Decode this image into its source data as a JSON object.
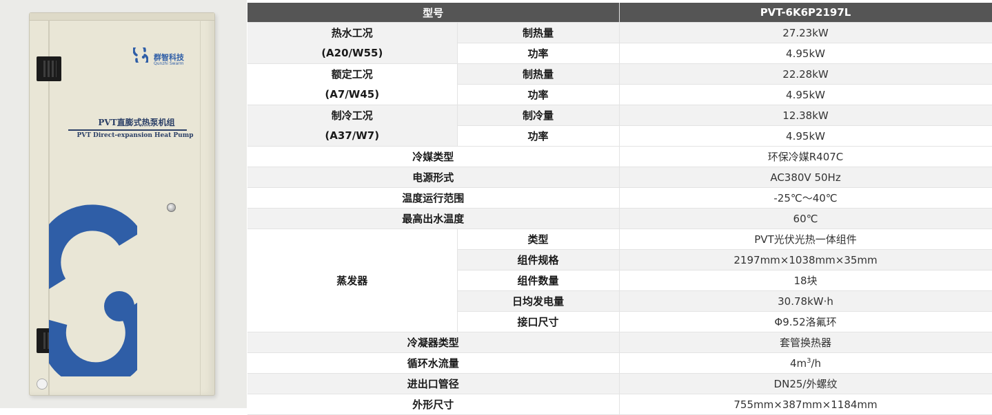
{
  "product": {
    "brand_name": "群智科技",
    "brand_sub": "Qunzhi Swarm",
    "title_cn": "PVT直膨式热泵机组",
    "title_en": "PVT Direct-expansion Heat Pump",
    "brand_color": "#2f5ea7"
  },
  "table": {
    "header": {
      "label": "型号",
      "value": "PVT-6K6P2197L"
    },
    "hot_water": {
      "label_line1": "热水工况",
      "label_line2": "(A20/W55)",
      "heat_label": "制热量",
      "heat_value": "27.23kW",
      "power_label": "功率",
      "power_value": "4.95kW"
    },
    "rated": {
      "label_line1": "额定工况",
      "label_line2": "(A7/W45)",
      "heat_label": "制热量",
      "heat_value": "22.28kW",
      "power_label": "功率",
      "power_value": "4.95kW"
    },
    "cooling": {
      "label_line1": "制冷工况",
      "label_line2": "(A37/W7)",
      "cool_label": "制冷量",
      "cool_value": "12.38kW",
      "power_label": "功率",
      "power_value": "4.95kW"
    },
    "refrigerant": {
      "label": "冷媒类型",
      "value": "环保冷媒R407C"
    },
    "power_supply": {
      "label": "电源形式",
      "value": "AC380V 50Hz"
    },
    "temp_range": {
      "label": "温度运行范围",
      "value": "-25℃～40℃"
    },
    "max_water_temp": {
      "label": "最高出水温度",
      "value": "60℃"
    },
    "evaporator": {
      "label": "蒸发器",
      "type_label": "类型",
      "type_value": "PVT光伏光热一体组件",
      "spec_label": "组件规格",
      "spec_value": "2197mm×1038mm×35mm",
      "count_label": "组件数量",
      "count_value": "18块",
      "daily_label": "日均发电量",
      "daily_value": "30.78kW·h",
      "port_label": "接口尺寸",
      "port_value": "Φ9.52洛氟环"
    },
    "condenser": {
      "label": "冷凝器类型",
      "value": "套管换热器"
    },
    "flow": {
      "label": "循环水流量",
      "value_number": "4m",
      "value_sup": "3",
      "value_unit": "/h"
    },
    "pipe": {
      "label": "进出口管径",
      "value": "DN25/外螺纹"
    },
    "dimensions": {
      "label": "外形尺寸",
      "value": "755mm×387mm×1184mm"
    }
  }
}
